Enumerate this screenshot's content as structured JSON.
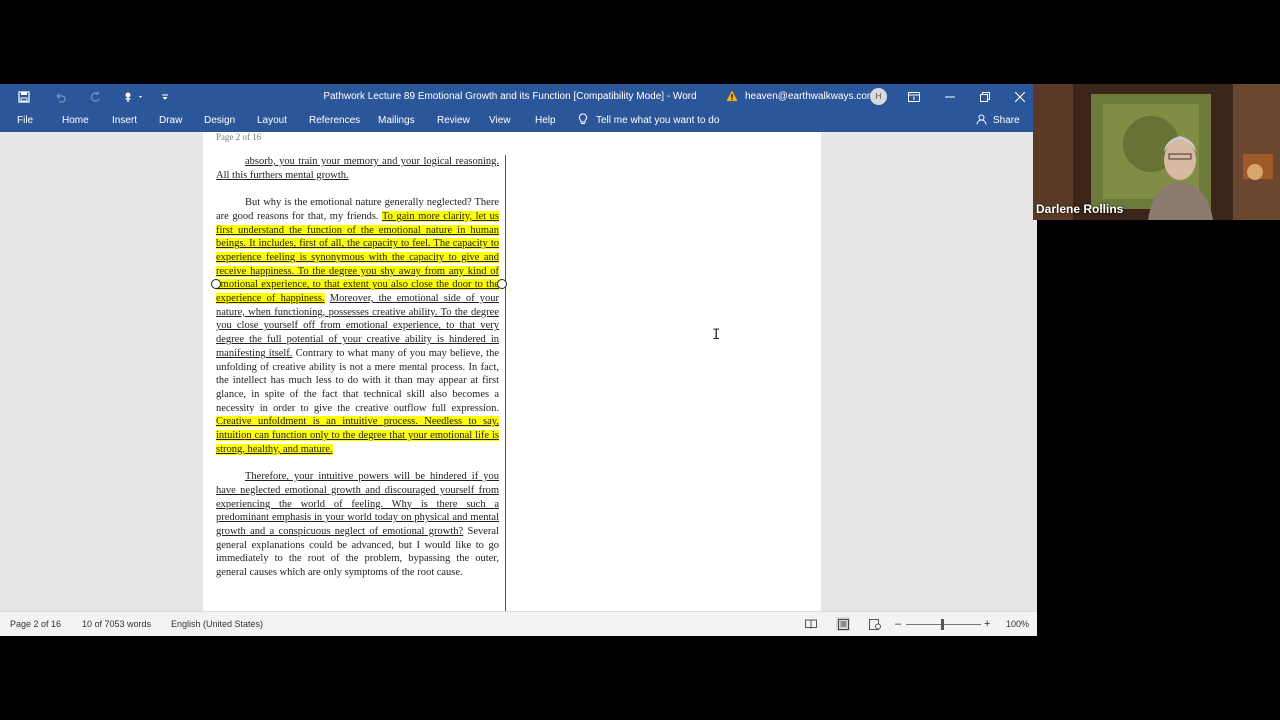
{
  "titlebar": {
    "document_title": "Pathwork Lecture 89 Emotional Growth and its Function [Compatibility Mode]  -  Word",
    "account_email": "heaven@earthwalkways.com",
    "avatar_initial": "H"
  },
  "ribbon": {
    "tabs": [
      "File",
      "Home",
      "Insert",
      "Draw",
      "Design",
      "Layout",
      "References",
      "Mailings",
      "Review",
      "View",
      "Help"
    ],
    "tell_me": "Tell me what you want to do",
    "share": "Share"
  },
  "document": {
    "page_label": "Page 2 of 16",
    "para1_text": "absorb, you train your memory and your logical reasoning.  All this furthers mental growth.",
    "para2": [
      {
        "text": "But why is the emotional nature generally neglected? There are good reasons for that, my friends.  ",
        "style": "plain"
      },
      {
        "text": "To gain more clarity, let us first understand the function of the emotional nature in human beings.  It includes, first of all, the capacity to feel.  The capacity to experience feeling is synonymous with the capacity to give and receive happiness.  To the degree you shy away from any kind of emotional experience, to that extent you also close the door to the experience of happiness.",
        "style": "hl"
      },
      {
        "text": "  ",
        "style": "plain"
      },
      {
        "text": "Moreover, the emotional side of your nature, when functioning, possesses creative ability. To the degree you close yourself off from emotional experience, to that very degree the full potential of your creative ability is hindered in manifesting itself.",
        "style": "u"
      },
      {
        "text": "  Contrary to what many of you may believe, the unfolding of creative ability is not a mere mental process.  In fact, the intellect has much less to do with it than may appear at first glance, in spite of the fact that technical skill also becomes a necessity in order to give the creative outflow full expression.   ",
        "style": "plain"
      },
      {
        "text": "Creative unfoldment is an intuitive process. Needless to say, intuition can function only to the degree that your emotional life is strong, healthy, and mature.",
        "style": "hl"
      }
    ],
    "para3": [
      {
        "text": "Therefore, your intuitive powers will be hindered if you have neglected emotional growth and discouraged yourself from experiencing the world of feeling.  Why is there such a predominant emphasis in your world today on physical and mental growth and a conspicuous neglect of emotional growth?",
        "style": "u"
      },
      {
        "text": "  Several general explanations could be advanced, but I would like to go immediately to the root of the problem, bypassing the outer, general causes which are only symptoms of the root cause.",
        "style": "plain"
      }
    ]
  },
  "statusbar": {
    "page": "Page 2 of 16",
    "words": "10 of 7053 words",
    "language": "English (United States)",
    "zoom": "100%",
    "zoom_level_percent": 100
  },
  "video": {
    "participant_name": "Darlene Rollins"
  },
  "colors": {
    "word_blue": "#2b579a",
    "highlight": "#ffff00",
    "canvas_gray": "#e6e6e6"
  }
}
